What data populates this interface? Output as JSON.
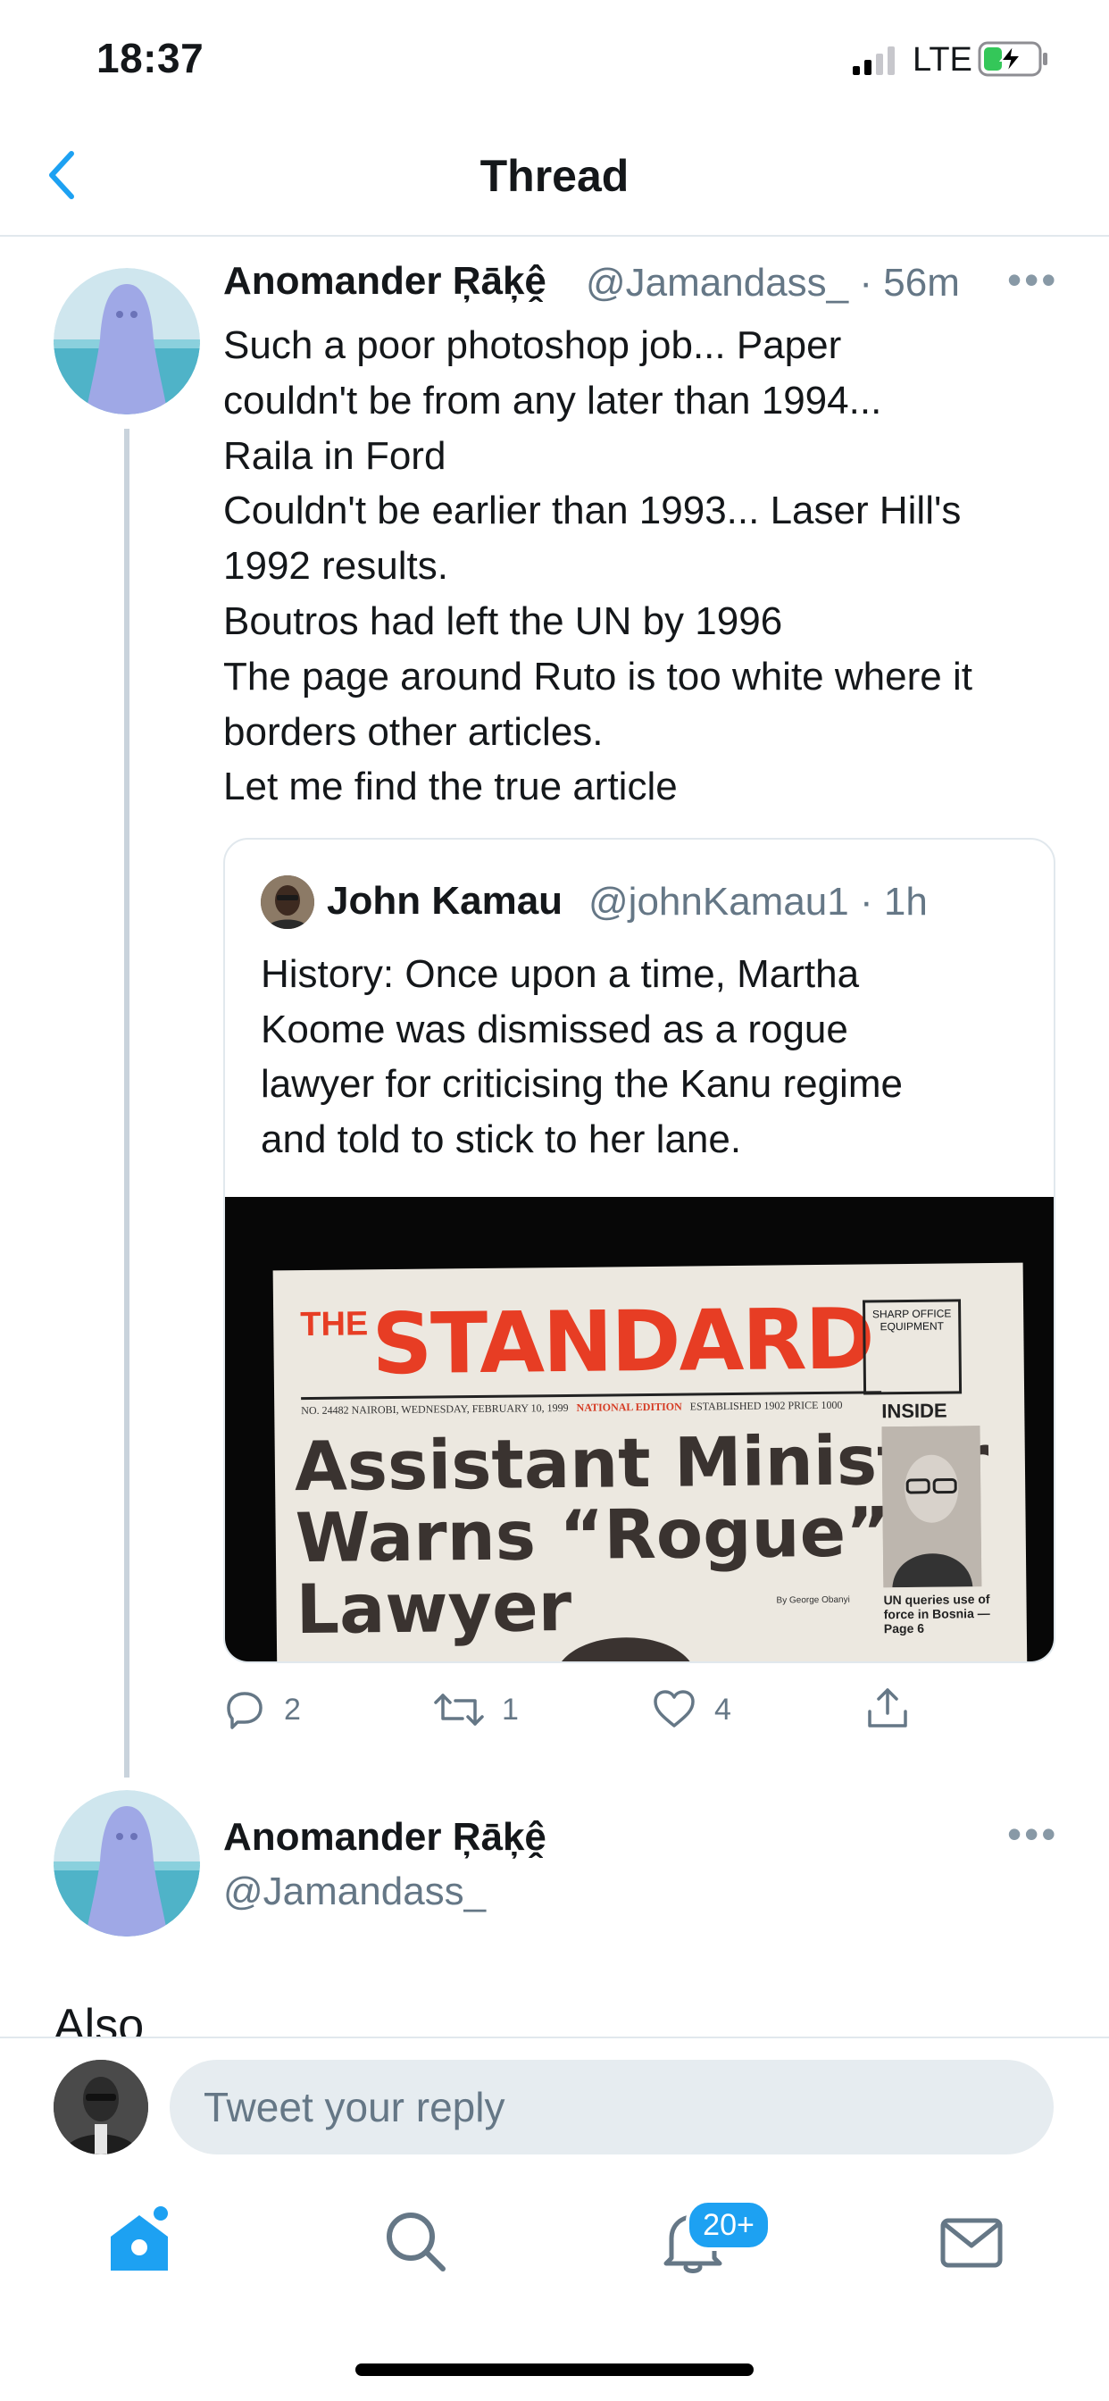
{
  "status_bar": {
    "time": "18:37",
    "network": "LTE",
    "icons": [
      "signal-icon",
      "battery-charging-icon"
    ]
  },
  "header": {
    "title": "Thread",
    "back_icon": "chevron-left-icon"
  },
  "tweet": {
    "author_name": "Anomander Ŗāķḙ̂",
    "handle": "@Jamandass_",
    "separator": "·",
    "time": "56m",
    "more": "•••",
    "body_lines": [
      "Such a poor photoshop job... Paper",
      "couldn't be from any later than 1994...",
      "Raila in Ford",
      "Couldn't be earlier than 1993... Laser Hill's",
      "1992 results.",
      "Boutros had left the UN by 1996",
      "The page around Ruto is too white where it",
      "borders other articles.",
      "Let me find the true article"
    ],
    "quoted": {
      "author_name": "John Kamau",
      "handle": "@johnKamau1",
      "separator": "·",
      "time": "1h",
      "body_lines": [
        "History: Once upon a time, Martha",
        "Koome was dismissed as a rogue",
        "lawyer for criticising the Kanu regime",
        "and told to stick to her lane."
      ],
      "newspaper": {
        "the": "THE",
        "masthead": "STANDARD",
        "dateline": "NO. 24482   NAIROBI, WEDNESDAY, FEBRUARY 10, 1999",
        "edition": "NATIONAL EDITION",
        "established": "ESTABLISHED 1902   PRICE 1000",
        "sharp": "SHARP OFFICE EQUIPMENT",
        "headline_lines": [
          "Assistant Minister",
          "Warns “Rogue”",
          "Lawyer"
        ],
        "inside": "INSIDE",
        "inside_text": "UN queries use of force in Bosnia — Page 6",
        "byline": "By George Obanyi"
      }
    },
    "actions": {
      "replies": "2",
      "retweets": "1",
      "likes": "4"
    }
  },
  "reply_tweet": {
    "author_name": "Anomander Ŗāķḙ̂",
    "handle": "@Jamandass_",
    "more": "•••",
    "peek_text": "Also"
  },
  "composer": {
    "placeholder": "Tweet your reply"
  },
  "tab_bar": {
    "notifications_badge": "20+"
  },
  "colors": {
    "accent": "#1da1f2",
    "secondary_text": "#657786",
    "divider": "#e1e8ed",
    "masthead_red": "#e73d24"
  }
}
